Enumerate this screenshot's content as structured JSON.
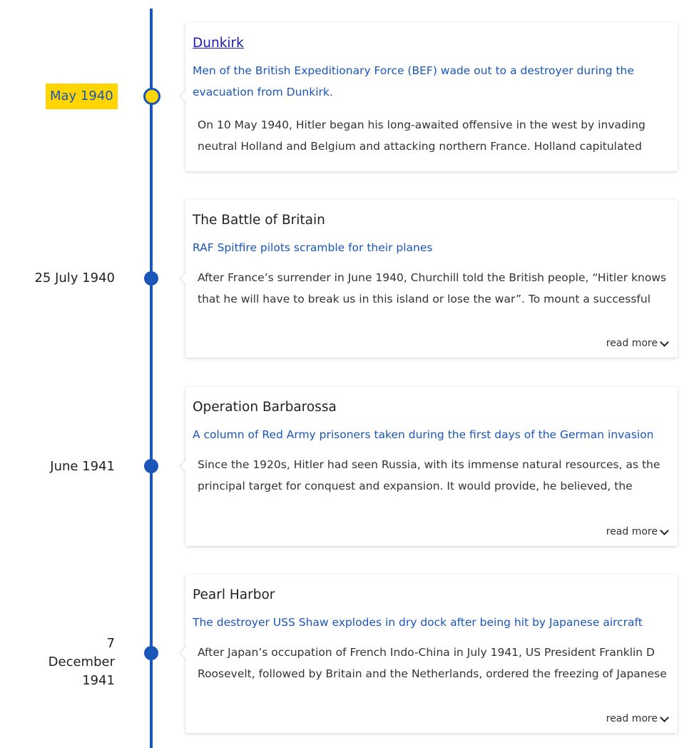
{
  "timeline": {
    "read_more_label": "read more",
    "events": [
      {
        "date": "May 1940",
        "title": "Dunkirk",
        "caption": "Men of the British Expeditionary Force (BEF) wade out to a destroyer during the evacuation from Dunkirk.",
        "body": "On 10 May 1940, Hitler began his long-awaited offensive in the west by invading neutral Holland and Belgium and attacking northern France. Holland capitulated after"
      },
      {
        "date": "25 July 1940",
        "title": "The Battle of Britain",
        "caption": "RAF Spitfire pilots scramble for their planes",
        "body": "After France’s surrender in June 1940, Churchill told the British people, “Hitler knows that he will have to break us in this island or lose the war”. To mount a successful"
      },
      {
        "date": "June 1941",
        "title": "Operation Barbarossa",
        "caption": "A column of Red Army prisoners taken during the first days of the German invasion",
        "body": "Since the 1920s, Hitler had seen Russia, with its immense natural resources, as the principal target for conquest and expansion. It would provide, he believed, the"
      },
      {
        "date": "7 December 1941",
        "title": "Pearl Harbor",
        "caption": "The destroyer USS Shaw explodes in dry dock after being hit by Japanese aircraft",
        "body": "After Japan’s occupation of French Indo-China in July 1941, US President Franklin D Roosevelt, followed by Britain and the Netherlands, ordered the freezing of Japanese"
      }
    ]
  },
  "colors": {
    "accent": "#1a56b8",
    "highlight": "#ffd500"
  },
  "icons": {
    "expand": "chevron-down-icon"
  }
}
